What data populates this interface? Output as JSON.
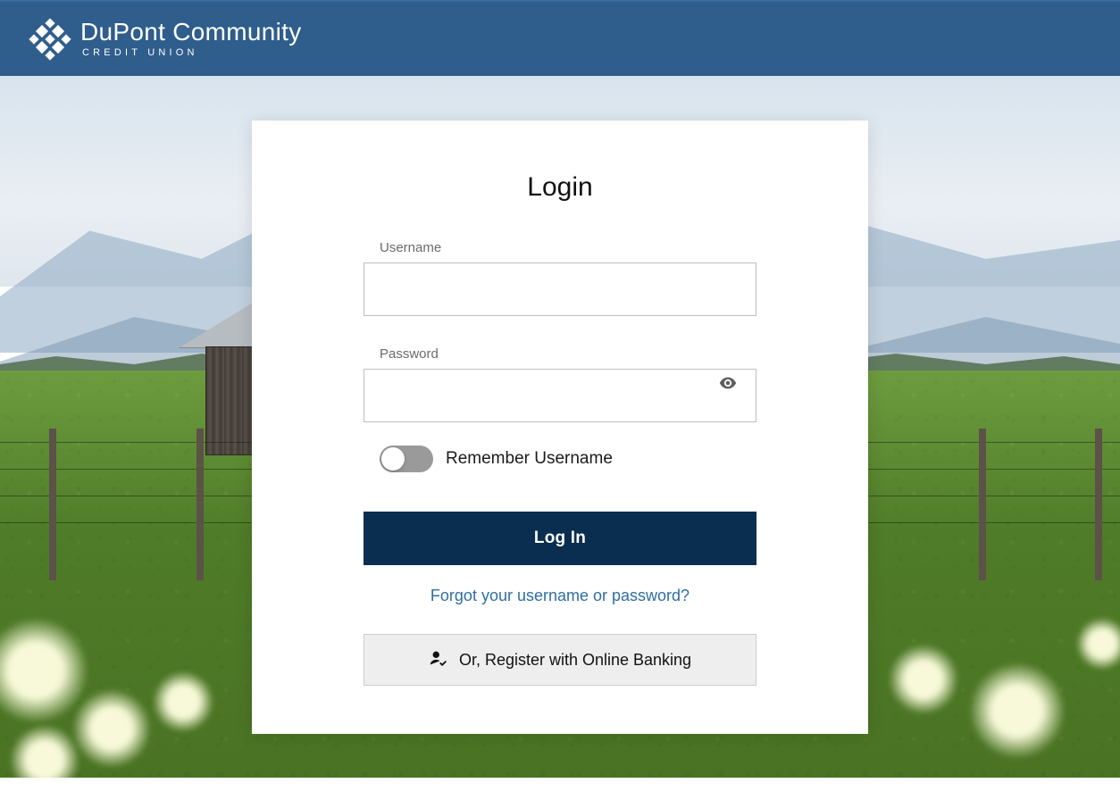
{
  "brand": {
    "name_line1": "DuPont Community",
    "name_line2": "CREDIT UNION"
  },
  "login": {
    "title": "Login",
    "username_label": "Username",
    "username_value": "",
    "password_label": "Password",
    "password_value": "",
    "remember_label": "Remember Username",
    "submit_label": "Log In",
    "forgot_label": "Forgot your username or password?",
    "register_label": "Or, Register with Online Banking"
  },
  "colors": {
    "header_bg": "#2f5d8c",
    "primary_btn_bg": "#0a2e4f",
    "link": "#2f6ea6"
  }
}
